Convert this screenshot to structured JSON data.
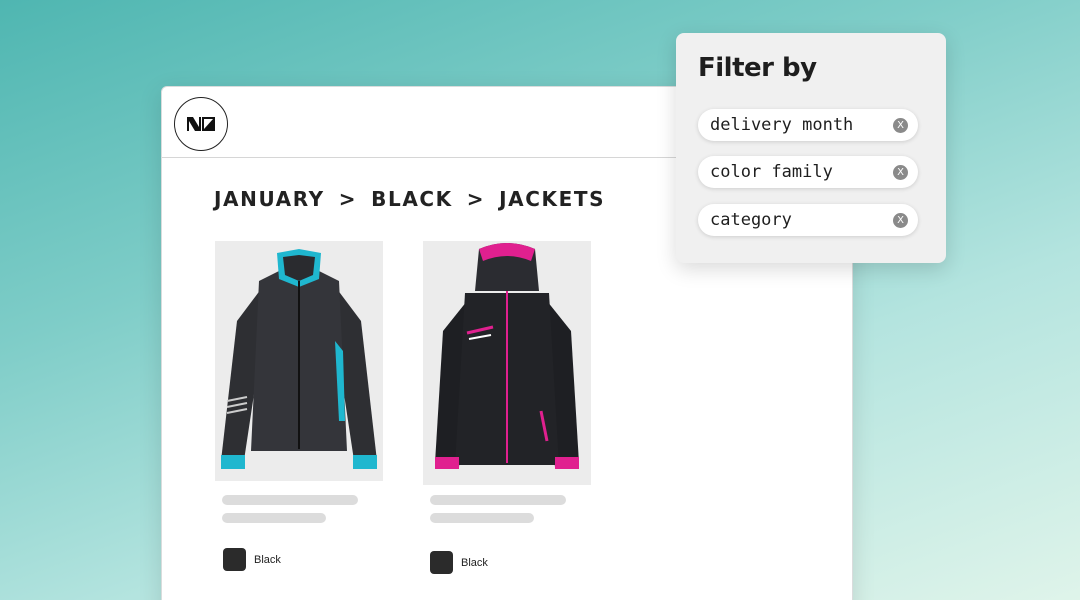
{
  "breadcrumb": {
    "items": [
      "JANUARY",
      "BLACK",
      "JACKETS"
    ],
    "separator": ">"
  },
  "products": [
    {
      "swatch_label": "Black",
      "accent_color": "#1fb7cf",
      "swatch_color": "#2b2b2b"
    },
    {
      "swatch_label": "Black",
      "accent_color": "#e0208f",
      "swatch_color": "#2b2b2b"
    }
  ],
  "filter": {
    "title": "Filter by",
    "chips": [
      {
        "label": "delivery month",
        "remove_glyph": "X"
      },
      {
        "label": "color family",
        "remove_glyph": "X"
      },
      {
        "label": "category",
        "remove_glyph": "X"
      }
    ]
  },
  "icons": {
    "logo": "brand-logo-icon",
    "remove": "close-icon"
  }
}
